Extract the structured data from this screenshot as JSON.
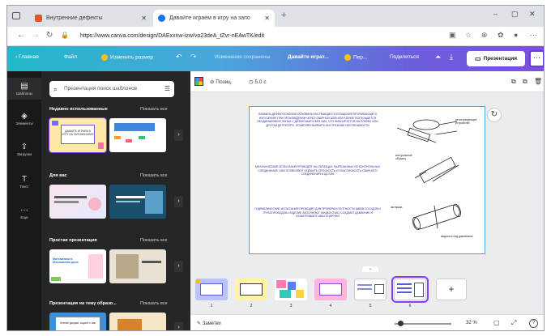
{
  "browser": {
    "tabs": [
      {
        "title": "Внутренние дефекты",
        "fav_color": "#e8532b"
      },
      {
        "title": "Давайте играем в игру на запо",
        "fav_color": "#1a73e8"
      }
    ],
    "url": "https://www.canva.com/design/DAExxnw-izw/vo23deA_tZvr-nEAwTK/edit",
    "new_tab": "+",
    "win_buttons": [
      "–",
      "▢",
      "✕"
    ]
  },
  "topbar": {
    "home": "Главная",
    "file": "Файл",
    "resize": "Изменить размер",
    "undo": "↶",
    "redo": "↷",
    "saved": "Изменения сохранены",
    "design_title": "Давайте играт...",
    "pro": "Пер...",
    "share": "Поделиться",
    "present": "Презентация",
    "more": "···"
  },
  "rail": [
    {
      "icon": "▤",
      "label": "Шаблоны"
    },
    {
      "icon": "◈",
      "label": "Элементы"
    },
    {
      "icon": "⇪",
      "label": "Загрузки"
    },
    {
      "icon": "T",
      "label": "Текст"
    },
    {
      "icon": "···",
      "label": "Еще"
    }
  ],
  "panel": {
    "search_placeholder": "Презентация поиск шаблонов",
    "sections": [
      {
        "title": "Недавно использованные",
        "all": "Показать все"
      },
      {
        "title": "Для вас",
        "all": "Показать все"
      },
      {
        "title": "Простая презентация",
        "all": "Показать все"
      },
      {
        "title": "Презентация на тему образо...",
        "all": "Показать все"
      }
    ],
    "thumb_texts": [
      "ДАВАЙТЕ ИГРАЕМ В ИГРУ НА ЗАПОМИНАНИЕ",
      "Математика в Московском доме",
      "Чтение дворян, ищите с нас"
    ]
  },
  "ctxbar": {
    "position": "Позиц.",
    "time": "5.0 с",
    "icons": [
      "⧉",
      "⧉",
      "🗑"
    ]
  },
  "slide": {
    "para1": "ПЛАВИЛЬ ДЕФЕКТОСКОПИИ ОСНОВАНЫ НА РЕАКЦИИ ПОГЛОЩЕНИЯ ПРОНИКАЮЩЕГО ИЗЛУЧЕНИЯ: ПРИ ПРОХОЖДЕНИИ ЧЕРЕЗ СВАРНОЙ ШОВ ИЗЛУЧЕНИЕ ПОГЛОЩАЕТСЯ НЕОДИНАКОВО В ЗОНАХ С ДЕФЕКТАМИ И БЕЗ НИХ, ЧТО ФИКСИРУЕТСЯ НА ПЛЁНКЕ ИЛИ ДРУГОМ ДЕТЕКТОРЕ, ПОЗВОЛЯЯ ВЫЯВИТЬ ВНУТРЕННИЕ НЕСПЛОШНОСТИ",
    "para2": "МЕХАНИЧЕСКИЕ ИСПЫТАНИЯ ПРОВОДЯТ НА ОБРАЗЦАХ, ВЫРЕЗАННЫХ ИЗ КОНТРОЛЬНЫХ СОЕДИНЕНИЙ. ОНИ ПОЗВОЛЯЮТ ОЦЕНИТЬ ПРОЧНОСТЬ И ПЛАСТИЧНОСТЬ СВАРНОГО СОЕДИНЕНИЯ В ЦЕЛОМ",
    "para3": "ГИДРАВЛИЧЕСКИЕ ИСПЫТАНИЯ ПРОВОДЯТ ДЛЯ ПРОВЕРКИ ПЛОТНОСТИ ШВОВ СОСУДОВ И ТРУБОПРОВОДОВ: ИЗДЕЛИЕ ЗАПОЛНЯЮТ ЖИДКОСТЬЮ, СОЗДАЮТ ДАВЛЕНИЕ И ОСМАТРИВАЮТ ШВЫ СНАРУЖИ",
    "labels": [
      "регистрирующее устройство",
      "контрольный образец",
      "заглушка",
      "жидкость под давлением"
    ]
  },
  "pages": [
    "1",
    "2",
    "3",
    "4",
    "5",
    "6"
  ],
  "add_page": "+",
  "footer": {
    "notes": "Заметки",
    "zoom": "32 %",
    "help": "?"
  }
}
